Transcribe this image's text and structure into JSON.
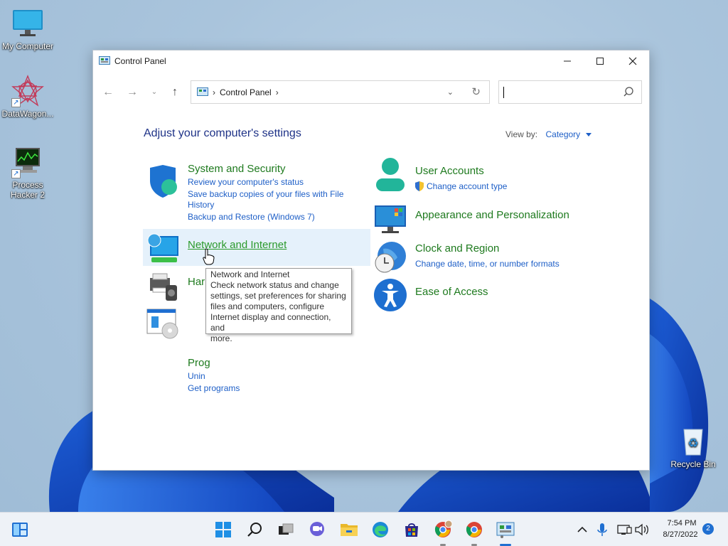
{
  "desktop": {
    "icons": [
      {
        "label": "My Computer"
      },
      {
        "label": "DataWagon..."
      },
      {
        "label": "Process Hacker 2"
      },
      {
        "label": "Recycle Bin"
      }
    ]
  },
  "window": {
    "title": "Control Panel",
    "address": {
      "crumb": "Control Panel"
    },
    "search": {
      "placeholder": ""
    }
  },
  "content": {
    "heading": "Adjust your computer's settings",
    "view_by_label": "View by:",
    "view_by_value": "Category",
    "categories": [
      {
        "title": "System and Security",
        "links": [
          "Review your computer's status",
          "Save backup copies of your files with File",
          "History",
          "Backup and Restore (Windows 7)"
        ]
      },
      {
        "title": "Network and Internet",
        "links": []
      },
      {
        "title": "Har",
        "links": []
      },
      {
        "title": "Prog",
        "links": [
          "Unin",
          "Get programs"
        ]
      },
      {
        "title": "User Accounts",
        "links": [
          "Change account type"
        ]
      },
      {
        "title": "Appearance and Personalization",
        "links": []
      },
      {
        "title": "Clock and Region",
        "links": [
          "Change date, time, or number formats"
        ]
      },
      {
        "title": "Ease of Access",
        "links": []
      }
    ]
  },
  "tooltip": {
    "title": "Network and Internet",
    "lines": [
      "Check network status and change",
      "settings, set preferences for sharing",
      "files and computers, configure",
      "Internet display and connection, and",
      "more."
    ]
  },
  "taskbar": {
    "time": "7:54 PM",
    "date": "8/27/2022",
    "notification_count": "2"
  },
  "colors": {
    "category_title": "#1e7a1e",
    "link": "#1e5fc7",
    "heading": "#1e3287",
    "accent": "#1f6fd1"
  }
}
